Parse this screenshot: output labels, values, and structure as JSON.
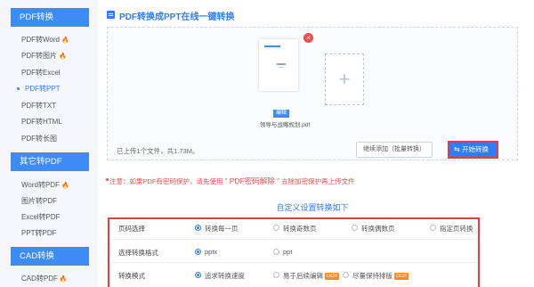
{
  "sidebar": {
    "sections": [
      {
        "title": "PDF转换",
        "items": [
          {
            "label": "PDF转Word",
            "hot": true
          },
          {
            "label": "PDF转图片",
            "hot": true
          },
          {
            "label": "PDF转Excel",
            "hot": false
          },
          {
            "label": "PDF转PPT",
            "hot": false,
            "active": true
          },
          {
            "label": "PDF转TXT",
            "hot": false
          },
          {
            "label": "PDF转HTML",
            "hot": false
          },
          {
            "label": "PDF转长图",
            "hot": false
          }
        ]
      },
      {
        "title": "其它转PDF",
        "items": [
          {
            "label": "Word转PDF",
            "hot": true
          },
          {
            "label": "图片转PDF",
            "hot": false
          },
          {
            "label": "Excel转PDF",
            "hot": false
          },
          {
            "label": "PPT转PDF",
            "hot": false
          }
        ]
      },
      {
        "title": "CAD转换",
        "items": [
          {
            "label": "CAD转PDF",
            "hot": true
          }
        ]
      }
    ]
  },
  "header": {
    "title": "PDF转换成PPT在线一键转换"
  },
  "upload": {
    "file": {
      "name": "领导与战略规划.pdf",
      "edit_label": "编辑",
      "close_glyph": "×"
    },
    "add_glyph": "+",
    "status": "已上传1个文件，共1.73M。",
    "batch_button": "继续添加（批量转换）",
    "convert_button": "开始转换"
  },
  "notice": {
    "prefix": "注意：如果PDF有密码保护，请先使用",
    "link": "“ PDF密码解除 ”",
    "suffix": "去除加密保护再上传文件"
  },
  "settings": {
    "title": "自定义设置转换如下",
    "rows": [
      {
        "label": "页码选择",
        "options": [
          {
            "text": "转换每一页",
            "checked": true
          },
          {
            "text": "转换奇数页",
            "checked": false
          },
          {
            "text": "转换偶数页",
            "checked": false
          },
          {
            "text": "指定页转换",
            "checked": false
          }
        ]
      },
      {
        "label": "选择转换格式",
        "options": [
          {
            "text": "pptx",
            "checked": true
          },
          {
            "text": "ppt",
            "checked": false
          }
        ]
      },
      {
        "label": "转换模式",
        "options": [
          {
            "text": "追求转换速度",
            "checked": true,
            "badge": ""
          },
          {
            "text": "易于后续编辑",
            "checked": false,
            "badge": "OCR"
          },
          {
            "text": "尽量保持排版",
            "checked": false,
            "badge": "OCR"
          }
        ]
      }
    ]
  },
  "colors": {
    "accent": "#2f7df6",
    "danger": "#f04d4d",
    "hot": "#ff6a1a",
    "highlight_border": "#ea3b3b"
  }
}
